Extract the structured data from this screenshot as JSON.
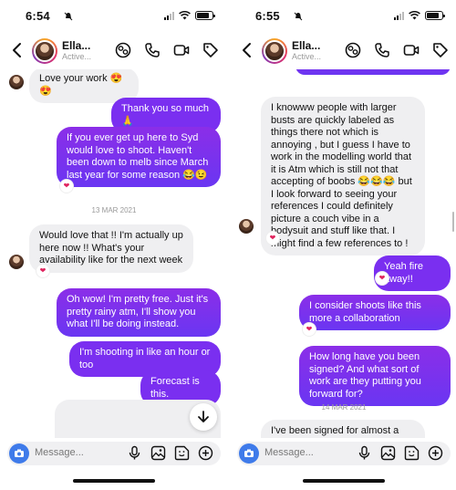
{
  "colors": {
    "accent": "#7a2ff0",
    "camera": "#3f7bea",
    "heart": "#e0245e"
  },
  "left": {
    "status": {
      "time": "6:54"
    },
    "header": {
      "name": "Ella...",
      "status": "Active..."
    },
    "messages": {
      "m1": "Love your work 😍😍",
      "m2": "Thank you so much 🙏",
      "m3": "If you ever get up here to Syd would love to shoot. Haven't been down to melb since March last year for some reason 😂😉",
      "date1": "13 MAR 2021",
      "m4": "Would love that !! I'm actually up here now !! What's your availability like for the next week",
      "m5": "Oh wow! I'm pretty free. Just it's pretty rainy atm, I'll show you what I'll be doing instead.",
      "m6": "I'm shooting in like an hour or too",
      "m7": "Forecast is this."
    },
    "composer": {
      "placeholder": "Message..."
    }
  },
  "right": {
    "status": {
      "time": "6:55"
    },
    "header": {
      "name": "Ella...",
      "status": "Active..."
    },
    "messages": {
      "m1": "I knowww people with larger busts are quickly labeled as things there not which is annoying , but I guess I have to work in the modelling world that it is Atm which is still not that accepting of boobs 😂😂😂 but I look forward to seeing your references I could definitely picture a couch vibe in a bodysuit and stuff like that. I might find a few references to !",
      "m2": "Yeah fire away!!",
      "m3": "I consider shoots like this more a collaboration",
      "m4": "How long have you been signed? And what sort of work are they putting you forward for?",
      "date1": "14 MAR 2021",
      "m5": "I've been signed for almost a year , I"
    },
    "composer": {
      "placeholder": "Message..."
    }
  },
  "icons": {
    "back": "chevron-left-icon",
    "effects": "effects-icon",
    "phone": "phone-icon",
    "video": "video-icon",
    "tag": "tag-icon",
    "camera": "camera-icon",
    "mic": "mic-icon",
    "gallery": "image-icon",
    "sticker": "sticker-icon",
    "add": "plus-circle-icon",
    "down": "arrow-down-icon",
    "heart": "heart-icon"
  }
}
